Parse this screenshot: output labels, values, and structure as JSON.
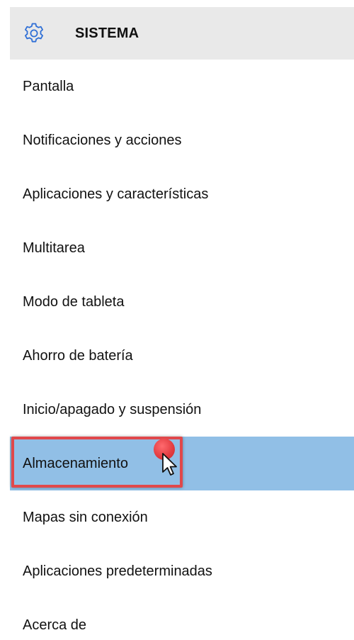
{
  "header": {
    "icon": "gear-icon",
    "title": "SISTEMA"
  },
  "nav": {
    "items": [
      {
        "label": "Pantalla"
      },
      {
        "label": "Notificaciones y acciones"
      },
      {
        "label": "Aplicaciones y características"
      },
      {
        "label": "Multitarea"
      },
      {
        "label": "Modo de tableta"
      },
      {
        "label": "Ahorro de batería"
      },
      {
        "label": "Inicio/apagado y suspensión"
      },
      {
        "label": "Almacenamiento",
        "selected": true
      },
      {
        "label": "Mapas sin conexión"
      },
      {
        "label": "Aplicaciones predeterminadas"
      },
      {
        "label": "Acerca de"
      }
    ]
  },
  "colors": {
    "accent": "#3a7bd5",
    "selected_bg": "#91bfe6",
    "header_bg": "#e9e9e9",
    "highlight": "#e0484b"
  }
}
